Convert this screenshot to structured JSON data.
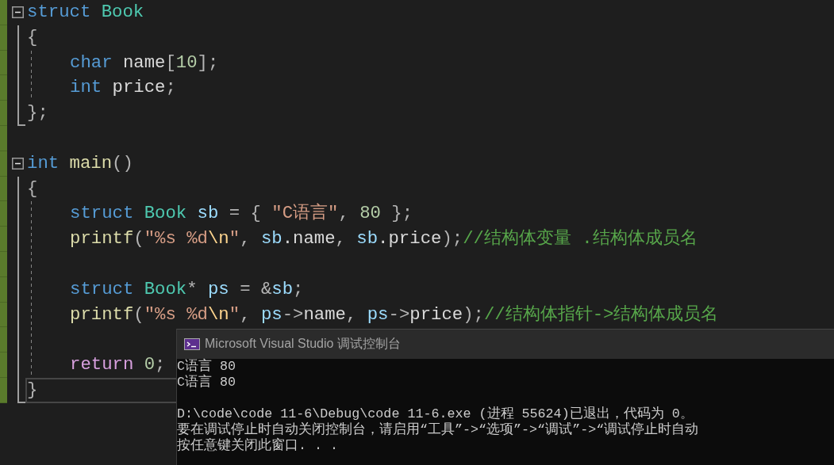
{
  "editor": {
    "lines": [
      {
        "kind": "fold",
        "changed": true,
        "current": false,
        "expanded": true,
        "tokens": [
          {
            "text": "struct ",
            "kind": "keyword"
          },
          {
            "text": "Book",
            "kind": "type"
          }
        ],
        "children": [
          {
            "kind": "line",
            "changed": true,
            "current": false,
            "tokens": [
              {
                "text": "{",
                "kind": "punct"
              }
            ]
          },
          {
            "kind": "block",
            "children": [
              {
                "kind": "line",
                "changed": true,
                "current": false,
                "tokens": [
                  {
                    "text": "char ",
                    "kind": "keyword"
                  },
                  {
                    "text": "name",
                    "kind": "field"
                  },
                  {
                    "text": "[",
                    "kind": "punct"
                  },
                  {
                    "text": "10",
                    "kind": "number"
                  },
                  {
                    "text": "];",
                    "kind": "punct"
                  }
                ]
              },
              {
                "kind": "line",
                "changed": true,
                "current": false,
                "tokens": [
                  {
                    "text": "int ",
                    "kind": "keyword"
                  },
                  {
                    "text": "price",
                    "kind": "field"
                  },
                  {
                    "text": ";",
                    "kind": "punct"
                  }
                ]
              }
            ]
          },
          {
            "kind": "line",
            "changed": true,
            "current": false,
            "tokens": [
              {
                "text": "};",
                "kind": "punct"
              }
            ]
          }
        ]
      },
      {
        "kind": "blank",
        "changed": true,
        "current": false
      },
      {
        "kind": "fold",
        "changed": true,
        "current": false,
        "expanded": true,
        "tokens": [
          {
            "text": "int ",
            "kind": "keyword"
          },
          {
            "text": "main",
            "kind": "function"
          },
          {
            "text": "()",
            "kind": "punct"
          }
        ],
        "children": [
          {
            "kind": "line",
            "changed": true,
            "current": false,
            "tokens": [
              {
                "text": "{",
                "kind": "punct"
              }
            ]
          },
          {
            "kind": "block",
            "children": [
              {
                "kind": "line",
                "changed": true,
                "current": false,
                "tokens": [
                  {
                    "text": "struct ",
                    "kind": "keyword"
                  },
                  {
                    "text": "Book ",
                    "kind": "type"
                  },
                  {
                    "text": "sb ",
                    "kind": "variable"
                  },
                  {
                    "text": "= { ",
                    "kind": "punct"
                  },
                  {
                    "text": "\"C语言\"",
                    "kind": "string"
                  },
                  {
                    "text": ", ",
                    "kind": "punct"
                  },
                  {
                    "text": "80 ",
                    "kind": "number"
                  },
                  {
                    "text": "};",
                    "kind": "punct"
                  }
                ]
              },
              {
                "kind": "line",
                "changed": true,
                "current": false,
                "tokens": [
                  {
                    "text": "printf",
                    "kind": "function"
                  },
                  {
                    "text": "(",
                    "kind": "punct"
                  },
                  {
                    "text": "\"%s %d",
                    "kind": "string"
                  },
                  {
                    "text": "\\n",
                    "kind": "escape"
                  },
                  {
                    "text": "\"",
                    "kind": "string"
                  },
                  {
                    "text": ", ",
                    "kind": "punct"
                  },
                  {
                    "text": "sb",
                    "kind": "variable"
                  },
                  {
                    "text": ".name",
                    "kind": "field"
                  },
                  {
                    "text": ", ",
                    "kind": "punct"
                  },
                  {
                    "text": "sb",
                    "kind": "variable"
                  },
                  {
                    "text": ".price",
                    "kind": "field"
                  },
                  {
                    "text": ");",
                    "kind": "punct"
                  },
                  {
                    "text": "//结构体变量 .结构体成员名",
                    "kind": "comment"
                  }
                ]
              },
              {
                "kind": "blank",
                "changed": true,
                "current": false
              },
              {
                "kind": "line",
                "changed": true,
                "current": false,
                "tokens": [
                  {
                    "text": "struct ",
                    "kind": "keyword"
                  },
                  {
                    "text": "Book",
                    "kind": "type"
                  },
                  {
                    "text": "* ",
                    "kind": "punct"
                  },
                  {
                    "text": "ps ",
                    "kind": "variable"
                  },
                  {
                    "text": "= &",
                    "kind": "punct"
                  },
                  {
                    "text": "sb",
                    "kind": "variable"
                  },
                  {
                    "text": ";",
                    "kind": "punct"
                  }
                ]
              },
              {
                "kind": "line",
                "changed": true,
                "current": false,
                "tokens": [
                  {
                    "text": "printf",
                    "kind": "function"
                  },
                  {
                    "text": "(",
                    "kind": "punct"
                  },
                  {
                    "text": "\"%s %d",
                    "kind": "string"
                  },
                  {
                    "text": "\\n",
                    "kind": "escape"
                  },
                  {
                    "text": "\"",
                    "kind": "string"
                  },
                  {
                    "text": ", ",
                    "kind": "punct"
                  },
                  {
                    "text": "ps",
                    "kind": "variable"
                  },
                  {
                    "text": "->",
                    "kind": "punct"
                  },
                  {
                    "text": "name",
                    "kind": "field"
                  },
                  {
                    "text": ", ",
                    "kind": "punct"
                  },
                  {
                    "text": "ps",
                    "kind": "variable"
                  },
                  {
                    "text": "->",
                    "kind": "punct"
                  },
                  {
                    "text": "price",
                    "kind": "field"
                  },
                  {
                    "text": ");",
                    "kind": "punct"
                  },
                  {
                    "text": "//结构体指针->结构体成员名",
                    "kind": "comment"
                  }
                ]
              },
              {
                "kind": "blank",
                "changed": true,
                "current": false
              },
              {
                "kind": "line",
                "changed": true,
                "current": false,
                "tokens": [
                  {
                    "text": "return ",
                    "kind": "control"
                  },
                  {
                    "text": "0",
                    "kind": "number"
                  },
                  {
                    "text": ";",
                    "kind": "punct"
                  }
                ]
              }
            ]
          },
          {
            "kind": "line",
            "changed": true,
            "current": true,
            "tokens": [
              {
                "text": "}",
                "kind": "punct"
              }
            ]
          }
        ]
      }
    ]
  },
  "console": {
    "title": "Microsoft Visual Studio 调试控制台",
    "output_lines": [
      "C语言 80",
      "C语言 80"
    ],
    "exit_messages": [
      "D:\\code\\code 11-6\\Debug\\code 11-6.exe (进程 55624)已退出，代码为 0。",
      "要在调试停止时自动关闭控制台，请启用“工具”->“选项”->“调试”->“调试停止时自动",
      "按任意键关闭此窗口. . ."
    ]
  }
}
